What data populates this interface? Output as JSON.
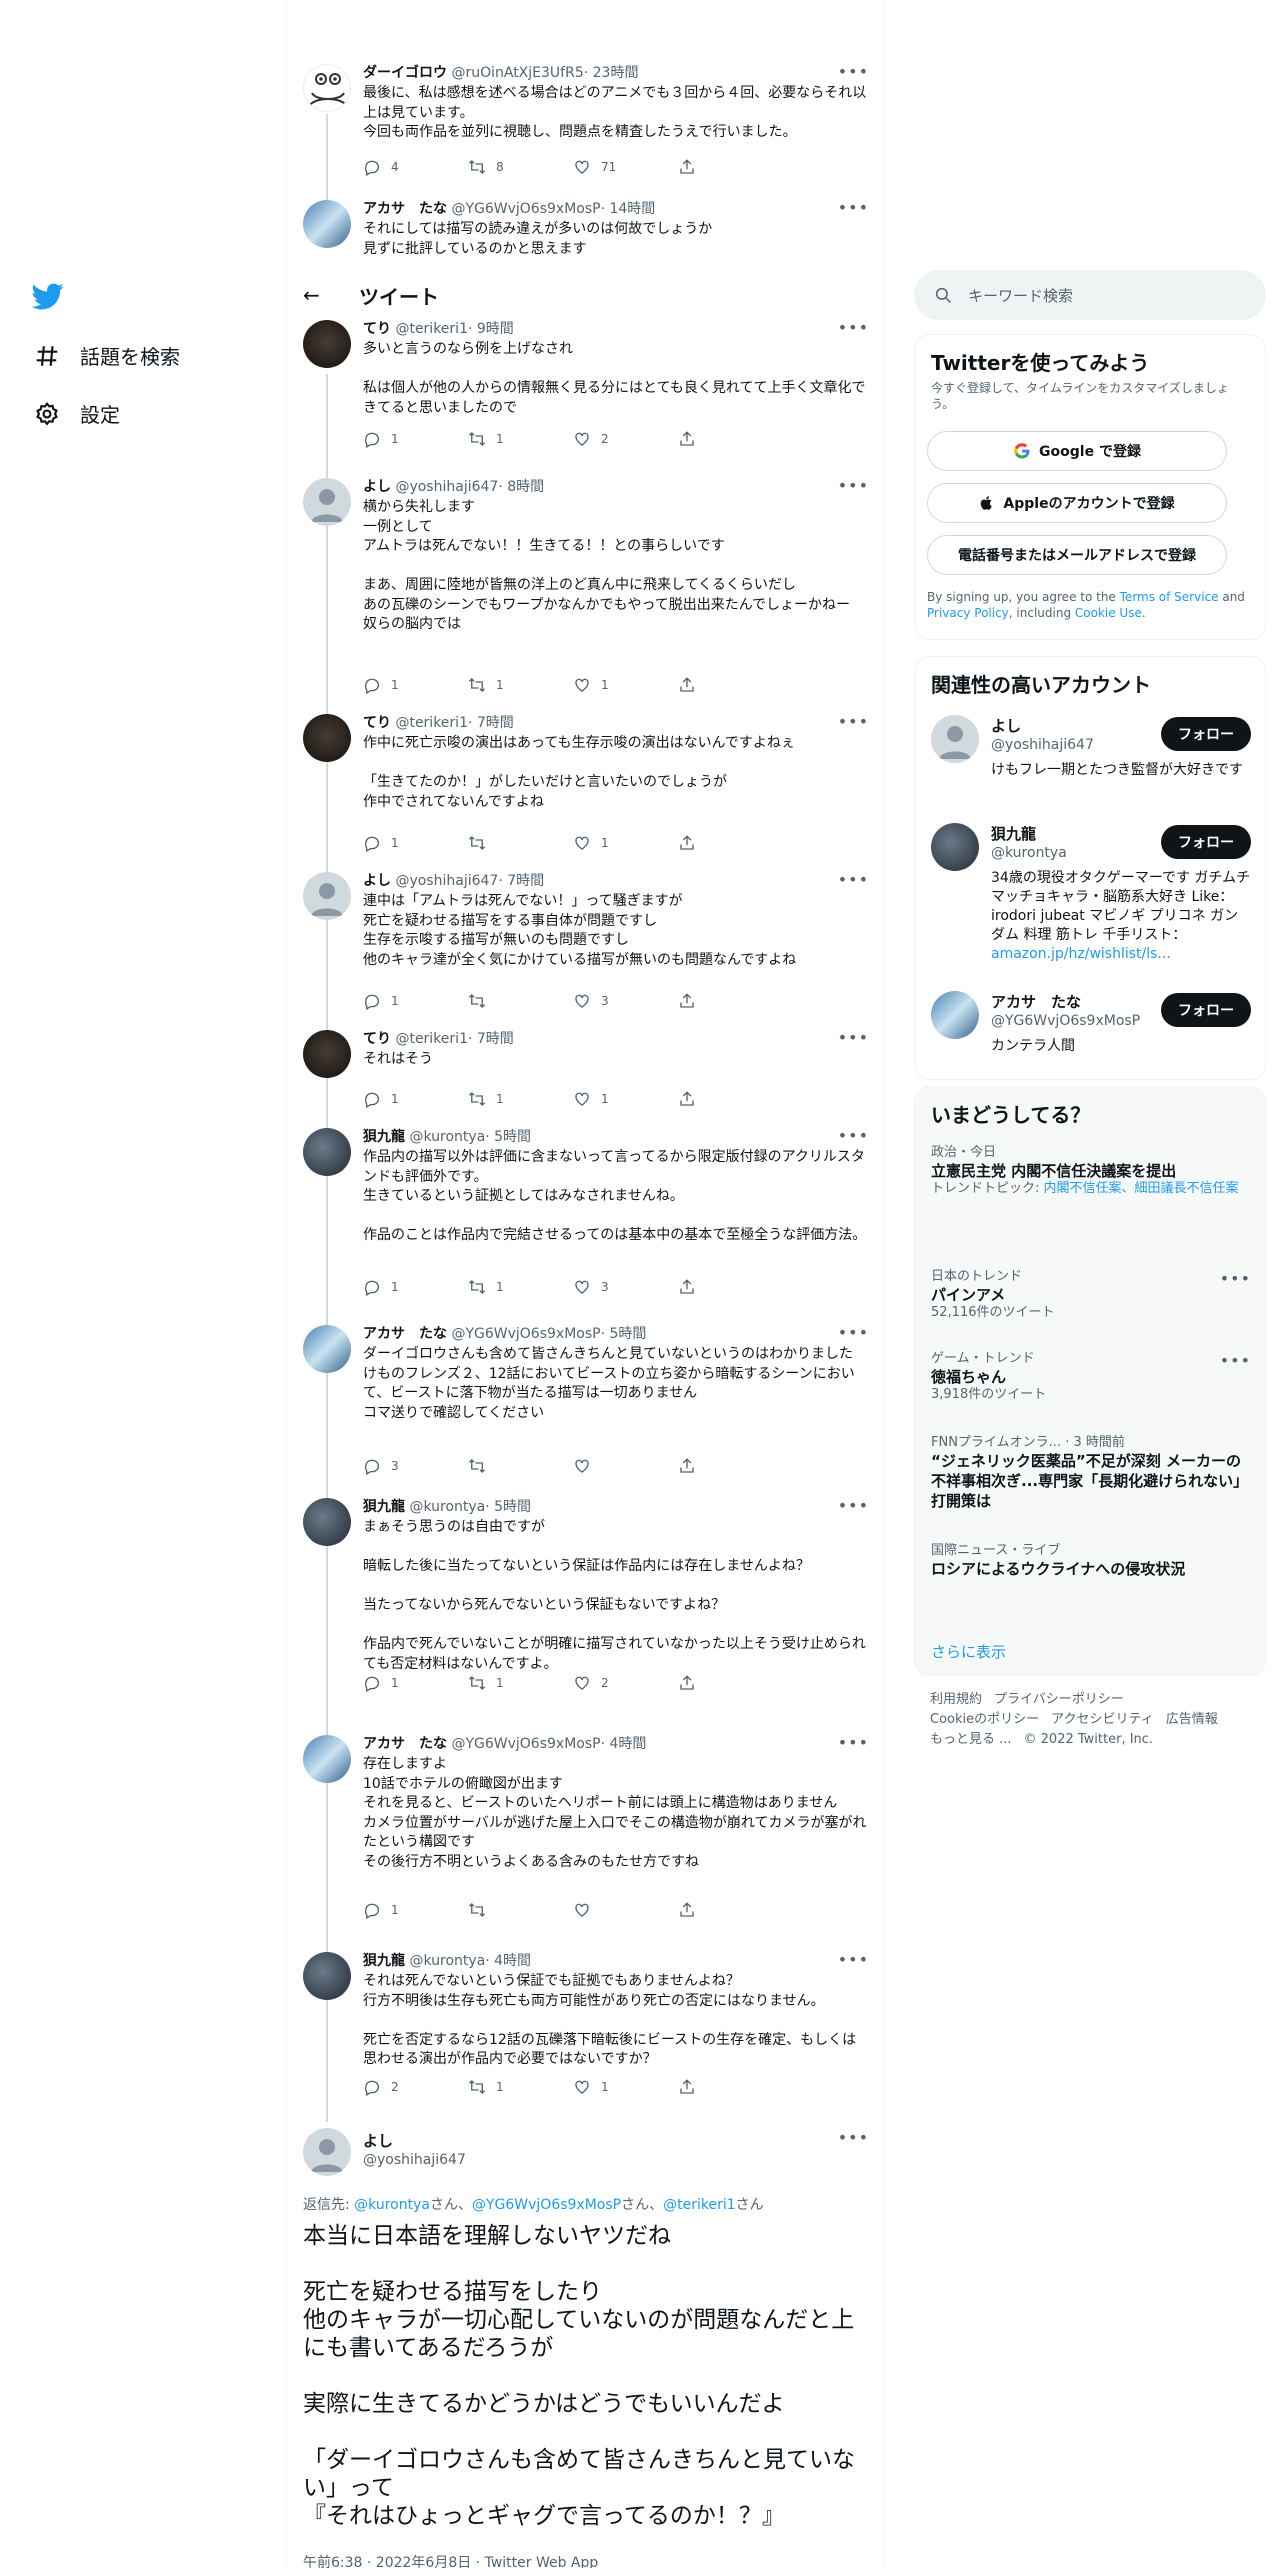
{
  "nav": {
    "search_label": "話題を検索",
    "settings_label": "設定"
  },
  "header": {
    "title": "ツイート"
  },
  "replies": [
    {
      "name": "ダーイゴロウ",
      "handle": "@ruOinAtXjE3UfR5",
      "time": "· 23時間",
      "text": "最後に、私は感想を述べる場合はどのアニメでも３回から４回、必要ならそれ以上は見ています。\n今回も両作品を並列に視聴し、問題点を精査したうえで行いました。",
      "reply": "4",
      "retweet": "8",
      "like": "71"
    },
    {
      "name": "アカサ　たな",
      "handle": "@YG6WvjO6s9xMosP",
      "time": "· 14時間",
      "text": "それにしては描写の読み違えが多いのは何故でしょうか\n見ずに批評しているのかと思えます",
      "reply": "",
      "retweet": "",
      "like": ""
    },
    {
      "name": "てり",
      "handle": "@terikeri1",
      "time": "· 9時間",
      "text": "多いと言うのなら例を上げなされ\n\n私は個人が他の人からの情報無く見る分にはとても良く見れてて上手く文章化できてると思いましたので",
      "reply": "1",
      "retweet": "1",
      "like": "2"
    },
    {
      "name": "よし",
      "handle": "@yoshihaji647",
      "time": "· 8時間",
      "text": "横から失礼します\n一例として\nアムトラは死んでない！！生きてる！！との事らしいです\n\nまあ、周囲に陸地が皆無の洋上のど真ん中に飛来してくるくらいだし\nあの瓦礫のシーンでもワープかなんかでもやって脱出出来たんでしょーかねー\n奴らの脳内では",
      "reply": "1",
      "retweet": "1",
      "like": "1"
    },
    {
      "name": "てり",
      "handle": "@terikeri1",
      "time": "· 7時間",
      "text": "作中に死亡示唆の演出はあっても生存示唆の演出はないんですよねぇ\n\n「生きてたのか！」がしたいだけと言いたいのでしょうが\n作中でされてないんですよね",
      "reply": "1",
      "retweet": "",
      "like": "1"
    },
    {
      "name": "よし",
      "handle": "@yoshihaji647",
      "time": "· 7時間",
      "text": "連中は「アムトラは死んでない！」って騒ぎますが\n死亡を疑わせる描写をする事自体が問題ですし\n生存を示唆する描写が無いのも問題ですし\n他のキャラ達が全く気にかけている描写が無いのも問題なんですよね",
      "reply": "1",
      "retweet": "",
      "like": "3"
    },
    {
      "name": "てり",
      "handle": "@terikeri1",
      "time": "· 7時間",
      "text": "それはそう",
      "reply": "1",
      "retweet": "1",
      "like": "1"
    },
    {
      "name": "狽九龍",
      "handle": "@kurontya",
      "time": "· 5時間",
      "text": "作品内の描写以外は評価に含まないって言ってるから限定版付録のアクリルスタンドも評価外です。\n生きているという証拠としてはみなされませんね。\n\n作品のことは作品内で完結させるってのは基本中の基本で至極全うな評価方法。",
      "reply": "1",
      "retweet": "1",
      "like": "3"
    },
    {
      "name": "アカサ　たな",
      "handle": "@YG6WvjO6s9xMosP",
      "time": "· 5時間",
      "text": "ダーイゴロウさんも含めて皆さんきちんと見ていないというのはわかりました\nけものフレンズ２、12話においてビーストの立ち姿から暗転するシーンにおいて、ビーストに落下物が当たる描写は一切ありません\nコマ送りで確認してください",
      "reply": "3",
      "retweet": "",
      "like": ""
    },
    {
      "name": "狽九龍",
      "handle": "@kurontya",
      "time": "· 5時間",
      "text": "まぁそう思うのは自由ですが\n\n暗転した後に当たってないという保証は作品内には存在しませんよね？\n\n当たってないから死んでないという保証もないですよね？\n\n作品内で死んでいないことが明確に描写されていなかった以上そう受け止められても否定材料はないんですよ。",
      "reply": "1",
      "retweet": "1",
      "like": "2"
    },
    {
      "name": "アカサ　たな",
      "handle": "@YG6WvjO6s9xMosP",
      "time": "· 4時間",
      "text": "存在しますよ\n10話でホテルの俯瞰図が出ます\nそれを見ると、ビーストのいたヘリポート前には頭上に構造物はありません\nカメラ位置がサーバルが逃げた屋上入口でそこの構造物が崩れてカメラが塞がれたという構図です\nその後行方不明というよくある含みのもたせ方ですね",
      "reply": "1",
      "retweet": "",
      "like": ""
    },
    {
      "name": "狽九龍",
      "handle": "@kurontya",
      "time": "· 4時間",
      "text": "それは死んでないという保証でも証拠でもありませんよね？\n行方不明後は生存も死亡も両方可能性があり死亡の否定にはなりません。\n\n死亡を否定するなら12話の瓦礫落下暗転後にビーストの生存を確定、もしくは思わせる演出が作品内で必要ではないですか？",
      "reply": "2",
      "retweet": "1",
      "like": "1"
    }
  ],
  "main_tweet": {
    "name": "よし",
    "handle": "@yoshihaji647",
    "reply_prefix": "返信先: ",
    "reply_to": [
      "@kurontya",
      "さん、",
      "@YG6WvjO6s9xMosP",
      "さん、",
      "@terikeri1",
      "さん"
    ],
    "text": "本当に日本語を理解しないヤツだね\n\n死亡を疑わせる描写をしたり\n他のキャラが一切心配していないのが問題なんだと上にも書いてあるだろうが\n\n実際に生きてるかどうかはどうでもいいんだよ\n\n「ダーイゴロウさんも含めて皆さんきちんと見ていない」って\n『それはひょっとギャグで言ってるのか！？』",
    "meta": "午前6:38 · 2022年6月8日 · Twitter Web App"
  },
  "search": {
    "placeholder": "キーワード検索"
  },
  "signup": {
    "title": "Twitterを使ってみよう",
    "subtitle": "今すぐ登録して、タイムラインをカスタマイズしましょう。",
    "google": "Google で登録",
    "apple": "Appleのアカウントで登録",
    "phone": "電話番号またはメールアドレスで登録",
    "terms_prefix": "By signing up, you agree to the ",
    "terms": "Terms of Service",
    "and": " and ",
    "privacy": "Privacy Policy",
    "including": ", including ",
    "cookie": "Cookie Use",
    "period": "."
  },
  "related": {
    "title": "関連性の高いアカウント",
    "follow": "フォロー",
    "accounts": [
      {
        "name": "よし",
        "handle": "@yoshihaji647",
        "bio": "けもフレ一期とたつき監督が大好きです"
      },
      {
        "name": "狽九龍",
        "handle": "@kurontya",
        "bio": "34歳の現役オタクゲーマーです ガチムチマッチョキャラ・脳筋系大好き Like： irodori jubeat マビノギ プリコネ ガンダム 料理 筋トレ 千手リスト：",
        "link": "amazon.jp/hz/wishlist/ls..."
      },
      {
        "name": "アカサ　たな",
        "handle": "@YG6WvjO6s9xMosP",
        "bio": "カンテラ人間"
      }
    ]
  },
  "trends": {
    "title": "いまどうしてる？",
    "items": [
      {
        "context": "政治・今日",
        "title": "立憲民主党 内閣不信任決議案を提出",
        "sub_prefix": "トレンドトピック: ",
        "sub_link": "内閣不信任案、細田議長不信任案"
      },
      {
        "context": "日本のトレンド",
        "title": "パインアメ",
        "sub": "52,116件のツイート"
      },
      {
        "context": "ゲーム・トレンド",
        "title": "徳福ちゃん",
        "sub": "3,918件のツイート"
      },
      {
        "context": "FNNプライムオンラ... · 3 時間前",
        "title": "“ジェネリック医薬品”不足が深刻 メーカーの不祥事相次ぎ...専門家「長期化避けられない」打開策は"
      },
      {
        "context": "国際ニュース・ライブ",
        "title": "ロシアによるウクライナへの侵攻状況"
      }
    ],
    "show_more": "さらに表示"
  },
  "footer": {
    "line1": [
      "利用規約",
      "プライバシーポリシー"
    ],
    "line2": [
      "Cookieのポリシー",
      "アクセシビリティ",
      "広告情報"
    ],
    "line3": [
      "もっと見る ...",
      "© 2022 Twitter, Inc."
    ]
  },
  "colors": {
    "accent": "#1d9bf0",
    "text": "#0f1419",
    "muted": "#536471"
  }
}
